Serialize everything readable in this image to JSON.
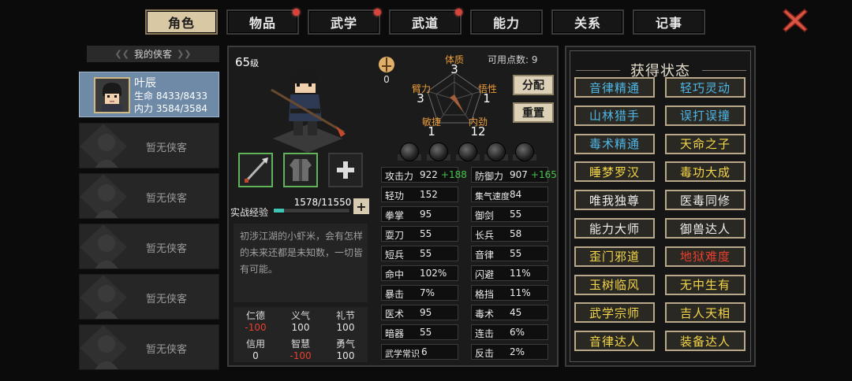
{
  "tabs": [
    {
      "label": "角色",
      "active": true,
      "badge": false
    },
    {
      "label": "物品",
      "active": false,
      "badge": true
    },
    {
      "label": "武学",
      "active": false,
      "badge": true
    },
    {
      "label": "武道",
      "active": false,
      "badge": true
    },
    {
      "label": "能力",
      "active": false,
      "badge": false
    },
    {
      "label": "关系",
      "active": false,
      "badge": false
    },
    {
      "label": "记事",
      "active": false,
      "badge": false
    }
  ],
  "roster": {
    "title": "我的侠客",
    "hero": {
      "name": "叶辰",
      "hp_label": "生命",
      "hp": "8433/8433",
      "mp_label": "内力",
      "mp": "3584/3584"
    },
    "empty_label": "暂无侠客"
  },
  "character": {
    "level": "65",
    "level_unit": "级",
    "exp_label": "实战经验",
    "exp_value": "1578/11550",
    "exp_fraction": 0.137,
    "description": "初涉江湖的小虾米，会有怎样的未来还都是未知数，一切皆有可能。",
    "talent_value": "0",
    "points_label": "可用点数:",
    "points_value": "9",
    "allocate_label": "分配",
    "reset_label": "重置"
  },
  "attributes": [
    {
      "name": "体质",
      "value": "3"
    },
    {
      "name": "悟性",
      "value": "1"
    },
    {
      "name": "内劲",
      "value": "12"
    },
    {
      "name": "敏捷",
      "value": "1"
    },
    {
      "name": "臂力",
      "value": "3"
    }
  ],
  "virtues": [
    {
      "name": "仁德",
      "value": "-100",
      "negative": true
    },
    {
      "name": "义气",
      "value": "100",
      "negative": false
    },
    {
      "name": "礼节",
      "value": "100",
      "negative": false
    },
    {
      "name": "信用",
      "value": "0",
      "negative": false
    },
    {
      "name": "智慧",
      "value": "-100",
      "negative": true
    },
    {
      "name": "勇气",
      "value": "100",
      "negative": false
    }
  ],
  "stats_left": [
    {
      "name": "攻击力",
      "value": "922",
      "bonus": "+188"
    },
    {
      "name": "轻功",
      "value": "152"
    },
    {
      "name": "拳掌",
      "value": "95"
    },
    {
      "name": "耍刀",
      "value": "55"
    },
    {
      "name": "短兵",
      "value": "55"
    },
    {
      "name": "命中",
      "value": "102%"
    },
    {
      "name": "暴击",
      "value": "7%"
    },
    {
      "name": "医术",
      "value": "95"
    },
    {
      "name": "暗器",
      "value": "55"
    },
    {
      "name": "武学常识",
      "value": "6"
    }
  ],
  "stats_right": [
    {
      "name": "防御力",
      "value": "907",
      "bonus": "+165"
    },
    {
      "name": "集气速度",
      "value": "84"
    },
    {
      "name": "御剑",
      "value": "55"
    },
    {
      "name": "长兵",
      "value": "58"
    },
    {
      "name": "音律",
      "value": "55"
    },
    {
      "name": "闪避",
      "value": "11%"
    },
    {
      "name": "格挡",
      "value": "11%"
    },
    {
      "name": "毒术",
      "value": "45"
    },
    {
      "name": "连击",
      "value": "6%"
    },
    {
      "name": "反击",
      "value": "2%"
    }
  ],
  "status": {
    "title": "获得状态",
    "items": [
      {
        "label": "音律精通",
        "color": "blue"
      },
      {
        "label": "轻巧灵动",
        "color": "blue"
      },
      {
        "label": "山林猎手",
        "color": "blue"
      },
      {
        "label": "误打误撞",
        "color": "blue"
      },
      {
        "label": "毒术精通",
        "color": "blue"
      },
      {
        "label": "天命之子",
        "color": "yellow"
      },
      {
        "label": "睡梦罗汉",
        "color": "yellow"
      },
      {
        "label": "毒功大成",
        "color": "yellow"
      },
      {
        "label": "唯我独尊",
        "color": "white"
      },
      {
        "label": "医毒同修",
        "color": "white"
      },
      {
        "label": "能力大师",
        "color": "white"
      },
      {
        "label": "御兽达人",
        "color": "white"
      },
      {
        "label": "歪门邪道",
        "color": "yellow"
      },
      {
        "label": "地狱难度",
        "color": "red"
      },
      {
        "label": "玉树临风",
        "color": "yellow"
      },
      {
        "label": "无中生有",
        "color": "yellow"
      },
      {
        "label": "武学宗师",
        "color": "yellow"
      },
      {
        "label": "吉人天相",
        "color": "yellow"
      },
      {
        "label": "音律达人",
        "color": "yellow"
      },
      {
        "label": "装备达人",
        "color": "yellow"
      }
    ]
  },
  "icons": {
    "close": "close-x-icon",
    "weapon": "spear-icon",
    "armor": "robe-icon",
    "add": "plus-icon",
    "talent": "sword-emblem-icon"
  },
  "colors": {
    "accent": "#dcd1b7",
    "exp": "#3ec4b3",
    "negative": "#e8402f",
    "bonus": "#46c24a"
  }
}
